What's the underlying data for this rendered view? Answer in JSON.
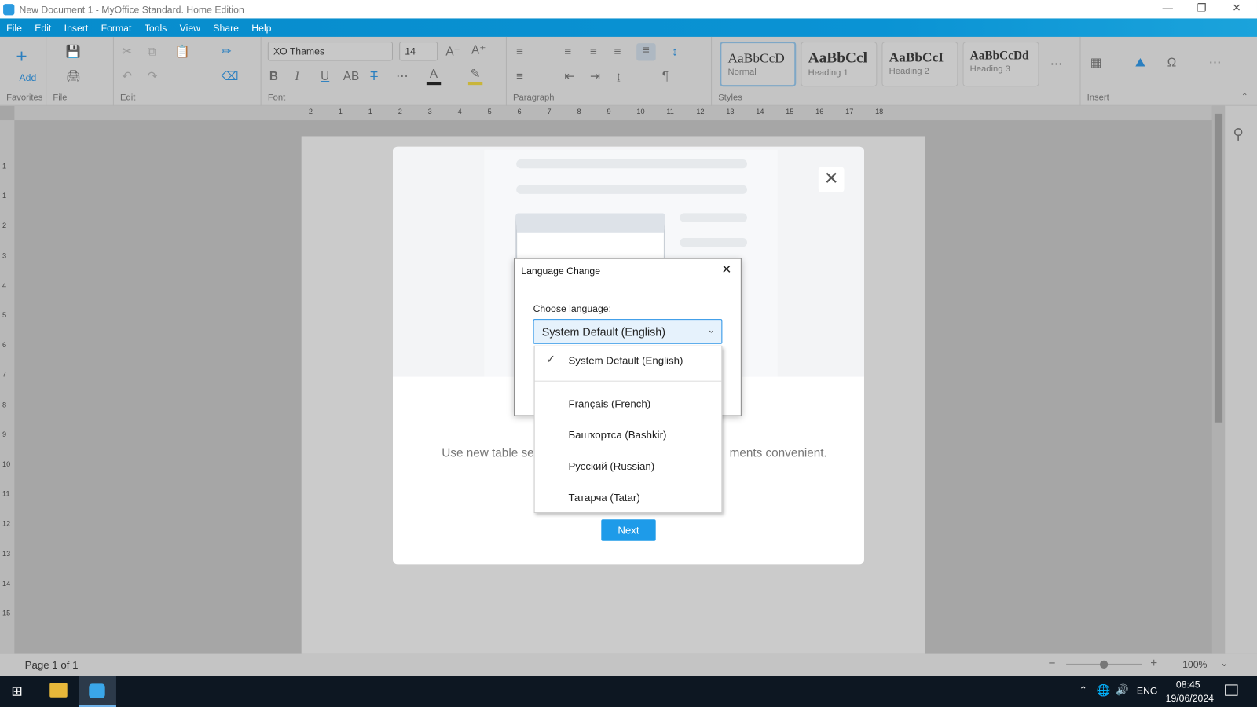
{
  "window": {
    "title": "New Document 1 - MyOffice Standard. Home Edition"
  },
  "menu": [
    "File",
    "Edit",
    "Insert",
    "Format",
    "Tools",
    "View",
    "Share",
    "Help"
  ],
  "ribbon": {
    "add_label": "Add",
    "groups": {
      "favorites": "Favorites",
      "file": "File",
      "edit": "Edit",
      "font": "Font",
      "paragraph": "Paragraph",
      "styles": "Styles",
      "insert": "Insert"
    },
    "font_name": "XO Thames",
    "font_size": "14",
    "styles": [
      {
        "sample": "AaBbCcD",
        "name": "Normal"
      },
      {
        "sample": "AaBbCcl",
        "name": "Heading 1"
      },
      {
        "sample": "AaBbCcI",
        "name": "Heading 2"
      },
      {
        "sample": "AaBbCcDd",
        "name": "Heading 3"
      }
    ]
  },
  "ruler": {
    "h": [
      "2",
      "1",
      "1",
      "2",
      "3",
      "4",
      "5",
      "6",
      "7",
      "8",
      "9",
      "10",
      "11",
      "12",
      "13",
      "14",
      "15",
      "16",
      "17",
      "18"
    ],
    "v": [
      "1",
      "1",
      "2",
      "3",
      "4",
      "5",
      "6",
      "7",
      "8",
      "9",
      "10",
      "11",
      "12",
      "13",
      "14",
      "15"
    ]
  },
  "onboarding": {
    "body_left": "Use new table se",
    "body_right": "ments convenient.",
    "next_label": "Next"
  },
  "language_dialog": {
    "title": "Language Change",
    "label": "Choose language:",
    "selected": "System Default (English)",
    "options": [
      "System Default (English)",
      "Français (French)",
      "Башҡортса (Bashkir)",
      "Русский (Russian)",
      "Татарча (Tatar)"
    ]
  },
  "status": {
    "page": "Page 1 of 1",
    "zoom": "100%",
    "zoom_fraction": 0.5
  },
  "taskbar": {
    "lang": "ENG",
    "time": "08:45",
    "date": "19/06/2024"
  },
  "colors": {
    "accent": "#1e9be9",
    "menubar": "#0a8fd0",
    "taskbar": "#0d1722"
  }
}
